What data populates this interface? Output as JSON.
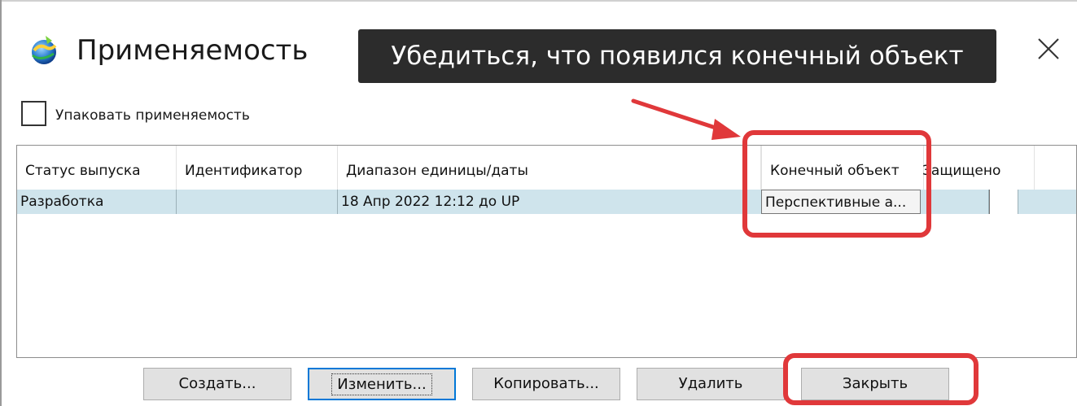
{
  "window": {
    "title": "Применяемость",
    "icon": "app-globe-icon",
    "close_icon": "close-icon"
  },
  "tooltip": {
    "text": "Убедиться, что появился конечный объект"
  },
  "pack_checkbox": {
    "label": "Упаковать применяемость",
    "checked": false
  },
  "table": {
    "columns": [
      "Статус выпуска",
      "Идентификатор",
      "Диапазон единицы/даты",
      "Конечный объект",
      "Защищено"
    ],
    "rows": [
      [
        "Разработка",
        "",
        "18 Апр 2022 12:12 до UP",
        "Перспективные а...",
        ""
      ]
    ],
    "selected_row": 0,
    "selected_color": "#cfe4ec"
  },
  "buttons": {
    "create": "Создать...",
    "edit": "Изменить...",
    "copy": "Копировать...",
    "delete": "Удалить",
    "close": "Закрыть"
  },
  "annotations": {
    "color": "#e0383a"
  }
}
